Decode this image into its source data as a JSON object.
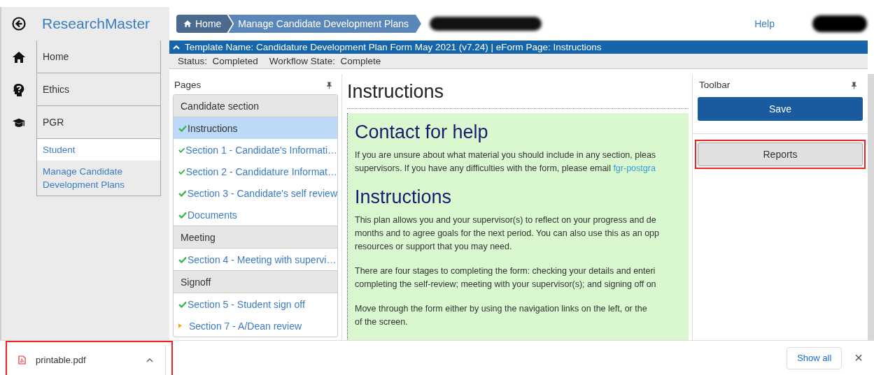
{
  "brand": "ResearchMaster",
  "menu": [
    {
      "label": "Home",
      "expanded": false
    },
    {
      "label": "Ethics",
      "expanded": false
    },
    {
      "label": "PGR",
      "expanded": true,
      "children": [
        {
          "label": "Student",
          "selected": true
        },
        {
          "label": "Manage Candidate Development Plans",
          "selected": false
        }
      ]
    }
  ],
  "breadcrumb": [
    "Home",
    "Manage Candidate Development Plans"
  ],
  "help": "Help",
  "template_bar": {
    "expanded": true,
    "text": "Template Name: Candidature Development Plan Form May 2021 (v7.24) | eForm Page: Instructions"
  },
  "status": [
    {
      "label": "Status:",
      "value": "Completed"
    },
    {
      "label": "Workflow State:",
      "value": "Complete"
    }
  ],
  "pages": {
    "title": "Pages",
    "groups": [
      {
        "name": "Candidate section",
        "items": [
          {
            "label": "Instructions",
            "completed": true,
            "selected": true
          },
          {
            "label": "Section 1 - Candidate's Informati…",
            "completed": true,
            "selected": false
          },
          {
            "label": "Section 2 - Candidature Informat…",
            "completed": true,
            "selected": false
          },
          {
            "label": "Section 3 - Candidate's self review",
            "completed": true,
            "selected": false
          },
          {
            "label": "Documents",
            "completed": true,
            "selected": false
          }
        ]
      },
      {
        "name": "Meeting",
        "items": [
          {
            "label": "Section 4 - Meeting with supervi…",
            "completed": true,
            "selected": false
          }
        ]
      },
      {
        "name": "Signoff",
        "items": [
          {
            "label": "Section 5 - Student sign off",
            "completed": true,
            "selected": false
          },
          {
            "label": "Section 7 - A/Dean review",
            "completed": false,
            "selected": false
          }
        ]
      }
    ]
  },
  "content": {
    "title": "Instructions",
    "sections": [
      {
        "heading": "Contact for help",
        "paragraphs": [
          {
            "lines": [
              "If you are unsure about what material you should include in any section, pleas",
              "supervisors. If you have any difficulties with the form, please email "
            ],
            "link": "fgr-postgra"
          }
        ]
      },
      {
        "heading": "Instructions",
        "paragraphs": [
          {
            "lines": [
              "This plan allows you and your supervisor(s) to reflect on your progress and de",
              "months and to agree goals for the next period. You can also use this as an opp",
              "resources or support that you may need."
            ]
          },
          {
            "lines": [
              "There are four stages to completing the form: checking your details and enteri",
              "completing the self-review; meeting with your supervisor(s); and signing off on"
            ]
          },
          {
            "lines": [
              "Move through the form either by using the navigation links on the left, or the",
              "of the screen."
            ]
          }
        ]
      }
    ]
  },
  "toolbar": {
    "title": "Toolbar",
    "buttons": [
      {
        "label": "Save",
        "kind": "primary",
        "highlighted": false
      },
      {
        "label": "Reports",
        "kind": "secondary",
        "highlighted": true
      }
    ]
  },
  "downloads": {
    "items": [
      {
        "name": "printable.pdf",
        "highlighted": true
      }
    ],
    "show_all": "Show all",
    "close": "×"
  }
}
